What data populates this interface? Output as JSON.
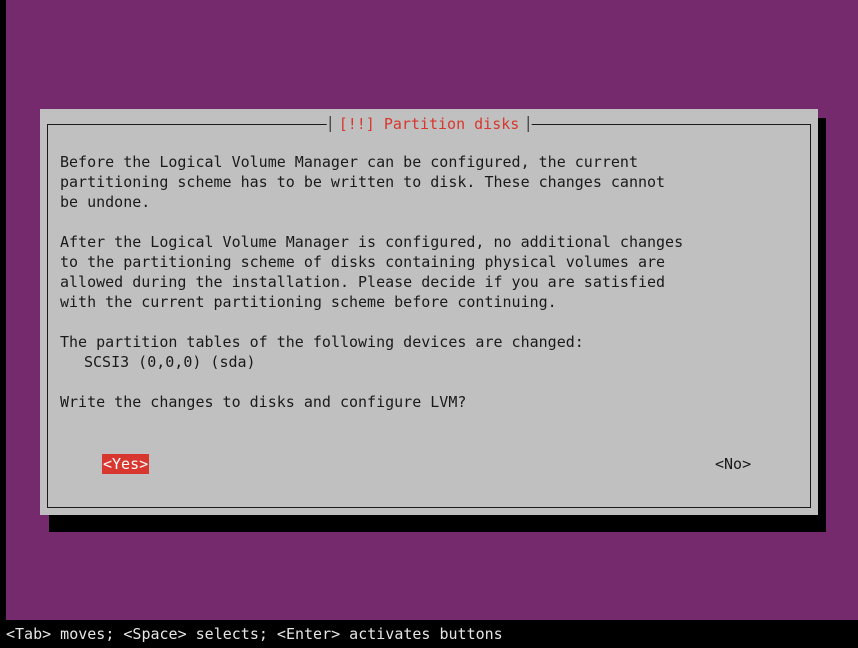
{
  "dialog": {
    "title": "[!!] Partition disks",
    "paragraphs": [
      "Before the Logical Volume Manager can be configured, the current\npartitioning scheme has to be written to disk. These changes cannot\nbe undone.",
      "After the Logical Volume Manager is configured, no additional changes\nto the partitioning scheme of disks containing physical volumes are\nallowed during the installation. Please decide if you are satisfied\nwith the current partitioning scheme before continuing.",
      "The partition tables of the following devices are changed:"
    ],
    "device": "SCSI3 (0,0,0) (sda)",
    "question": "Write the changes to disks and configure LVM?",
    "yes_label": "<Yes>",
    "no_label": "<No>"
  },
  "status_bar": "<Tab> moves; <Space> selects; <Enter> activates buttons",
  "colors": {
    "background": "#752a6d",
    "dialog": "#c0c0c0",
    "title": "#d7372e",
    "selected_button": "#d7372e"
  }
}
